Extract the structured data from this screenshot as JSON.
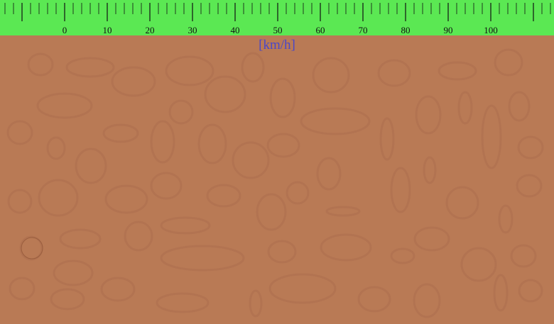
{
  "ruler": {
    "unit_label": "[km/h]",
    "tick_labels": [
      "0",
      "10",
      "20",
      "30",
      "40",
      "50",
      "60",
      "70",
      "80",
      "90",
      "100"
    ],
    "min": 0,
    "max": 100,
    "major_step": 10,
    "minor_step": 2,
    "color": "#5be853",
    "tick_color": "#111111"
  },
  "ground": {
    "color": "#b97a55",
    "pebble_color": "#b07150"
  }
}
